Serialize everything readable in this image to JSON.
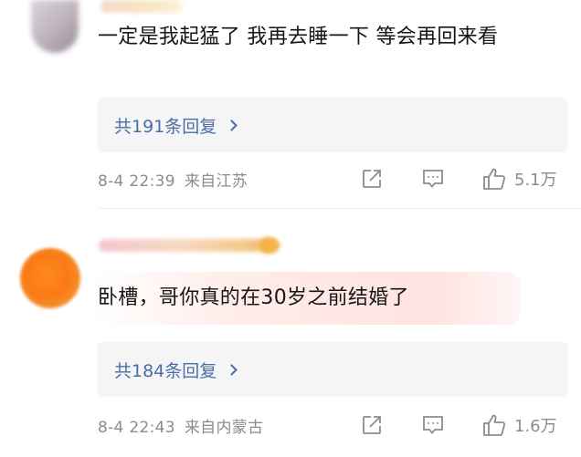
{
  "comments": [
    {
      "text": "一定是我起猛了  我再去睡一下 等会再回来看",
      "replies_label": "共191条回复",
      "date": "8-4 22:39",
      "location": "来自江苏",
      "likes": "5.1万"
    },
    {
      "text": "卧槽，哥你真的在30岁之前结婚了",
      "replies_label": "共184条回复",
      "date": "8-4 22:43",
      "location": "来自内蒙古",
      "likes": "1.6万"
    }
  ],
  "colors": {
    "link": "#4a6fa8",
    "meta": "#8c8c8c",
    "reply_bg": "#f5f5f5",
    "highlight": "#ffe3e1"
  },
  "icons": [
    "share-icon",
    "comment-icon",
    "like-icon",
    "chevron-right-icon"
  ]
}
